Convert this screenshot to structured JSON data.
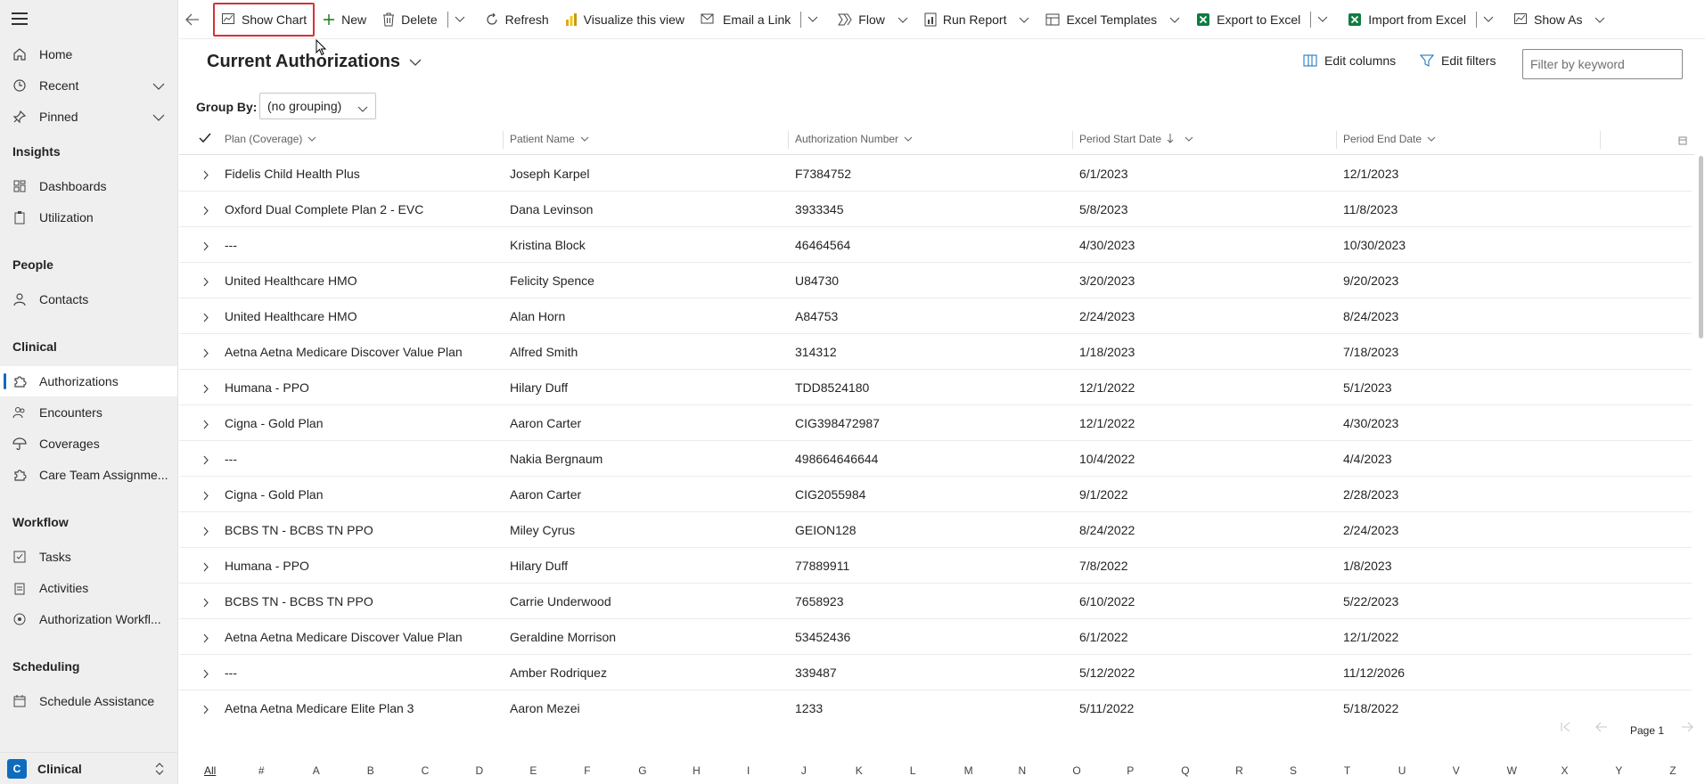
{
  "sidebar": {
    "items": [
      {
        "label": "Home",
        "icon": "home-icon"
      },
      {
        "label": "Recent",
        "icon": "clock-icon"
      },
      {
        "label": "Pinned",
        "icon": "pin-icon"
      }
    ],
    "sections": [
      {
        "title": "Insights",
        "items": [
          "Dashboards",
          "Utilization"
        ]
      },
      {
        "title": "People",
        "items": [
          "Contacts"
        ]
      },
      {
        "title": "Clinical",
        "items": [
          "Authorizations",
          "Encounters",
          "Coverages",
          "Care Team Assignme..."
        ]
      },
      {
        "title": "Workflow",
        "items": [
          "Tasks",
          "Activities",
          "Authorization Workfl..."
        ]
      },
      {
        "title": "Scheduling",
        "items": [
          "Schedule Assistance"
        ]
      }
    ],
    "area": {
      "badge": "C",
      "label": "Clinical"
    }
  },
  "toolbar": {
    "show_chart": "Show Chart",
    "new": "New",
    "delete": "Delete",
    "refresh": "Refresh",
    "visualize": "Visualize this view",
    "email_link": "Email a Link",
    "flow": "Flow",
    "run_report": "Run Report",
    "excel_templates": "Excel Templates",
    "export_excel": "Export to Excel",
    "import_excel": "Import from Excel",
    "show_as": "Show As"
  },
  "view": {
    "title": "Current Authorizations",
    "edit_columns": "Edit columns",
    "edit_filters": "Edit filters",
    "search_placeholder": "Filter by keyword",
    "group_by_label": "Group By:",
    "group_by_value": "(no grouping)"
  },
  "grid": {
    "columns": [
      "Plan (Coverage)",
      "Patient Name",
      "Authorization Number",
      "Period Start Date",
      "Period End Date"
    ],
    "rows": [
      [
        "Fidelis Child Health Plus",
        "Joseph Karpel",
        "F7384752",
        "6/1/2023",
        "12/1/2023"
      ],
      [
        "Oxford Dual Complete Plan 2 - EVC",
        "Dana Levinson",
        "3933345",
        "5/8/2023",
        "11/8/2023"
      ],
      [
        "---",
        "Kristina Block",
        "46464564",
        "4/30/2023",
        "10/30/2023"
      ],
      [
        "United Healthcare HMO",
        "Felicity Spence",
        "U84730",
        "3/20/2023",
        "9/20/2023"
      ],
      [
        "United Healthcare HMO",
        "Alan Horn",
        "A84753",
        "2/24/2023",
        "8/24/2023"
      ],
      [
        "Aetna Aetna Medicare Discover Value Plan",
        "Alfred Smith",
        "314312",
        "1/18/2023",
        "7/18/2023"
      ],
      [
        "Humana - PPO",
        "Hilary Duff",
        "TDD8524180",
        "12/1/2022",
        "5/1/2023"
      ],
      [
        "Cigna - Gold Plan",
        "Aaron Carter",
        "CIG398472987",
        "12/1/2022",
        "4/30/2023"
      ],
      [
        "---",
        "Nakia Bergnaum",
        "498664646644",
        "10/4/2022",
        "4/4/2023"
      ],
      [
        "Cigna - Gold Plan",
        "Aaron Carter",
        "CIG2055984",
        "9/1/2022",
        "2/28/2023"
      ],
      [
        "BCBS TN - BCBS TN PPO",
        "Miley Cyrus",
        "GEION128",
        "8/24/2022",
        "2/24/2023"
      ],
      [
        "Humana - PPO",
        "Hilary Duff",
        "77889911",
        "7/8/2022",
        "1/8/2023"
      ],
      [
        "BCBS TN - BCBS TN PPO",
        "Carrie Underwood",
        "7658923",
        "6/10/2022",
        "5/22/2023"
      ],
      [
        "Aetna Aetna Medicare Discover Value Plan",
        "Geraldine Morrison",
        "53452436",
        "6/1/2022",
        "12/1/2022"
      ],
      [
        "---",
        "Amber Rodriquez",
        "339487",
        "5/12/2022",
        "11/12/2026"
      ],
      [
        "Aetna Aetna Medicare Elite Plan 3",
        "Aaron Mezei",
        "1233",
        "5/11/2022",
        "5/18/2022"
      ]
    ]
  },
  "pager": {
    "label": "Page 1"
  },
  "alpha_index": [
    "All",
    "#",
    "A",
    "B",
    "C",
    "D",
    "E",
    "F",
    "G",
    "H",
    "I",
    "J",
    "K",
    "L",
    "M",
    "N",
    "O",
    "P",
    "Q",
    "R",
    "S",
    "T",
    "U",
    "V",
    "W",
    "X",
    "Y",
    "Z"
  ],
  "colors": {
    "accent": "#0f6cbd",
    "highlight_box": "#d13438",
    "sidebar_bg": "#efefef"
  }
}
